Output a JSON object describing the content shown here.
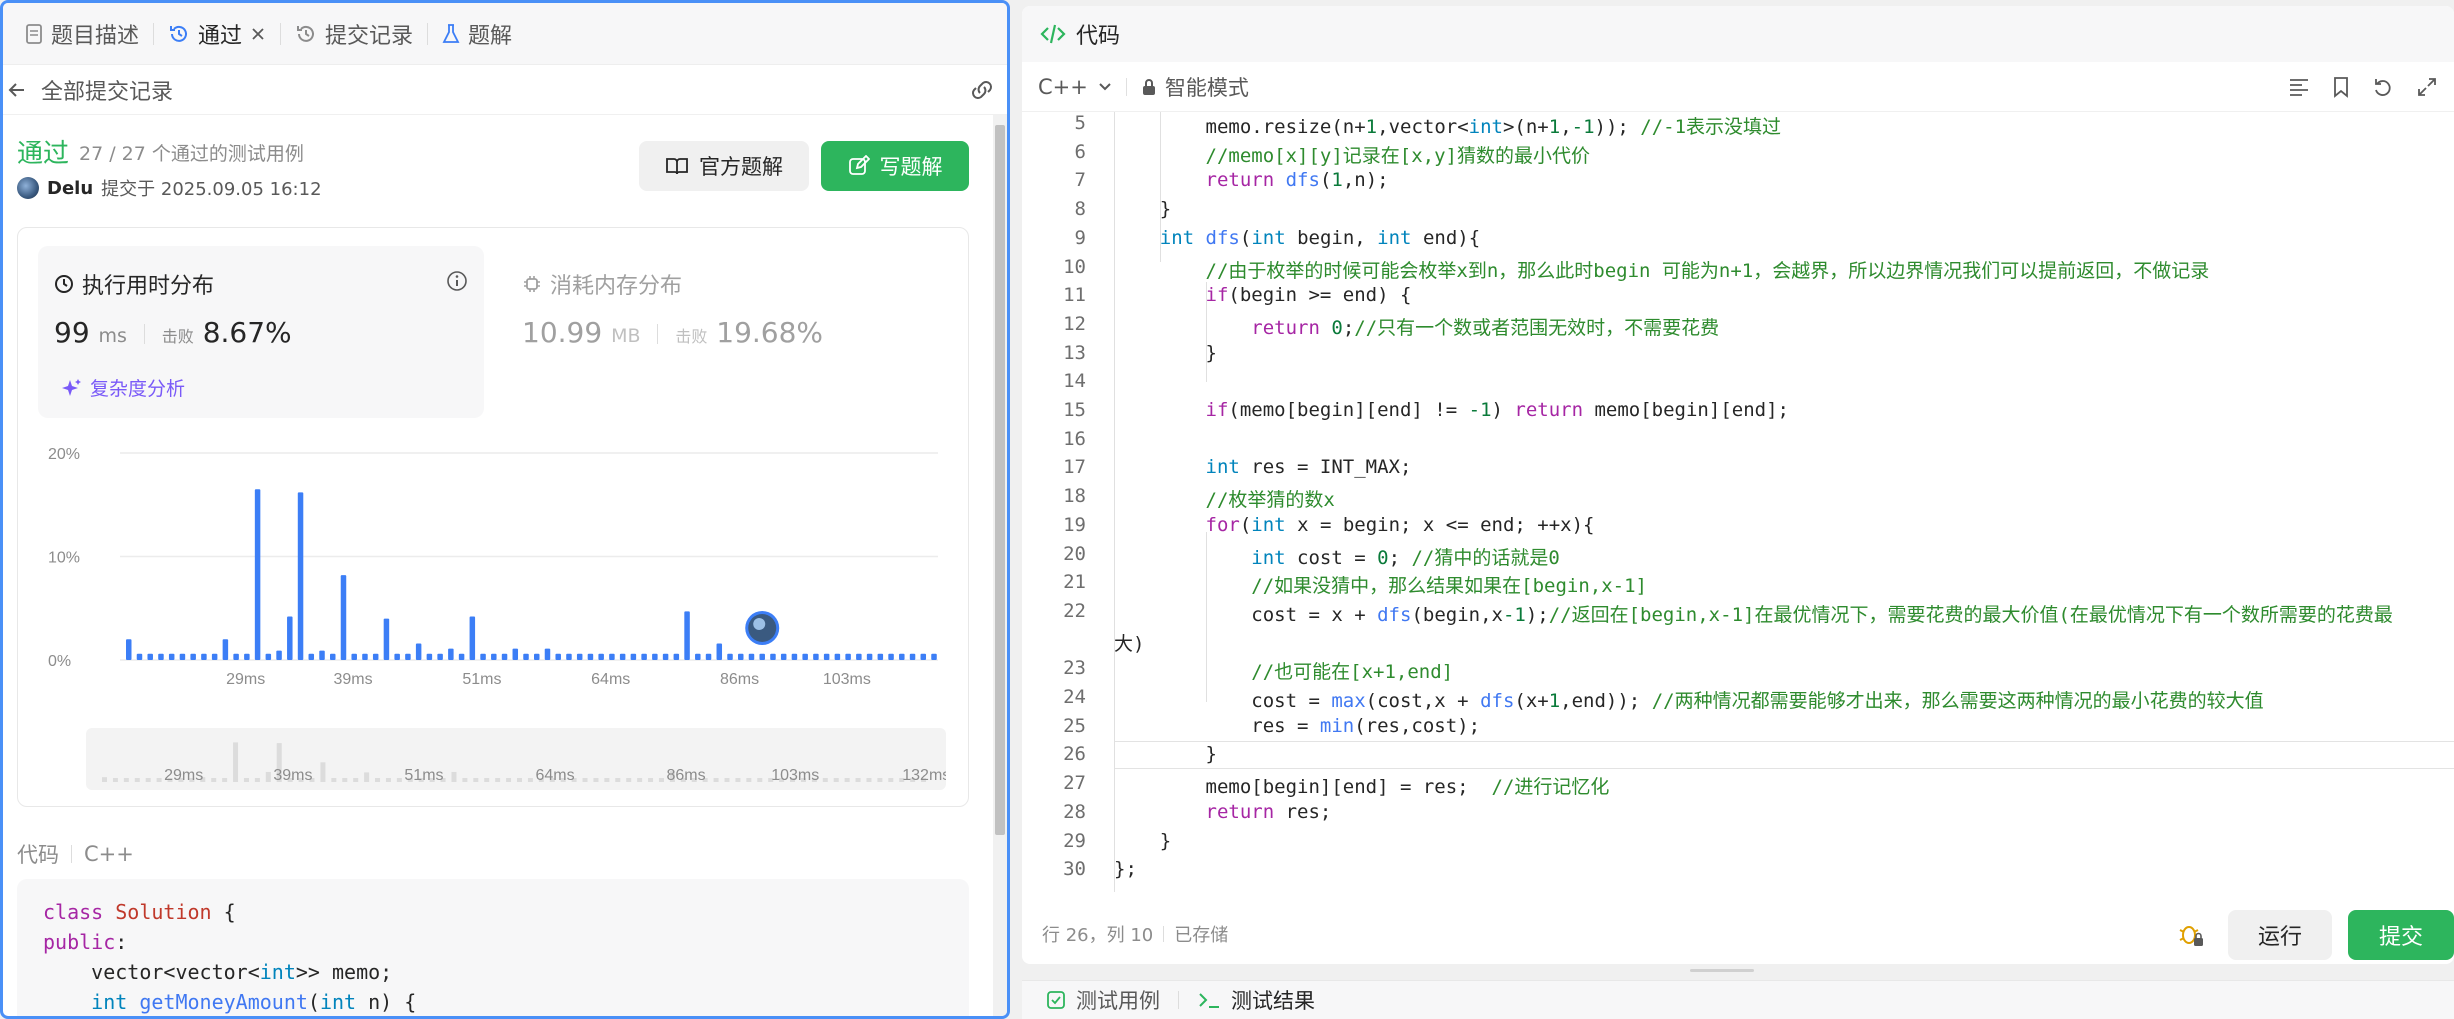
{
  "left_tabs": [
    {
      "label": "题目描述",
      "icon": "document-icon"
    },
    {
      "label": "通过",
      "icon": "history-icon",
      "active": true,
      "closable": true
    },
    {
      "label": "提交记录",
      "icon": "history-icon"
    },
    {
      "label": "题解",
      "icon": "flask-icon"
    }
  ],
  "header": {
    "back_label": "全部提交记录",
    "link_icon": "link-icon"
  },
  "submission": {
    "status": "通过",
    "testcases": "27 / 27 个通过的测试用例",
    "author": "Delu",
    "submitted_at": "提交于 2025.09.05 16:12",
    "official_solution": "官方题解",
    "write_solution": "写题解"
  },
  "runtime": {
    "title": "执行用时分布",
    "value": "99",
    "unit": "ms",
    "beat_label": "击败",
    "beat_pct": "8.67%",
    "complexity": "复杂度分析"
  },
  "memory": {
    "title": "消耗内存分布",
    "value": "10.99",
    "unit": "MB",
    "beat_label": "击败",
    "beat_pct": "19.68%"
  },
  "chart_data": {
    "type": "bar",
    "y_ticks": [
      "20%",
      "10%",
      "0%"
    ],
    "ylim": [
      0,
      20
    ],
    "x_ticks": [
      "29ms",
      "39ms",
      "51ms",
      "64ms",
      "86ms",
      "103ms",
      "132ms"
    ],
    "values": [
      2,
      0.6,
      0.6,
      0.6,
      0.6,
      0.6,
      0.6,
      0.6,
      0.6,
      2,
      0.6,
      0.6,
      16.5,
      0.6,
      0.9,
      4.2,
      16.2,
      0.6,
      0.9,
      0.6,
      8.2,
      0.6,
      0.6,
      0.6,
      4,
      0.6,
      0.6,
      1.6,
      0.6,
      0.6,
      1.1,
      0.6,
      4.2,
      0.6,
      0.6,
      0.6,
      1.1,
      0.6,
      0.6,
      1.1,
      0.6,
      0.6,
      0.6,
      0.6,
      0.6,
      0.6,
      0.6,
      0.6,
      0.6,
      0.6,
      0.6,
      0.6,
      4.7,
      0.6,
      0.6,
      1.6,
      0.6,
      0.6,
      0.6,
      0.6,
      0.6,
      0.6,
      0.6,
      0.6,
      0.6,
      0.6,
      0.6,
      0.6,
      0.6,
      0.6,
      0.6,
      0.6,
      0.6,
      0.6,
      0.6,
      0.6
    ],
    "user_marker_index": 59,
    "accent": "#3c7ef6"
  },
  "code_section": {
    "label": "代码",
    "lang": "C++"
  },
  "code_preview": [
    "class Solution {",
    "public:",
    "    vector<vector<int>> memo;",
    "    int getMoneyAmount(int n) {"
  ],
  "editor": {
    "title": "代码",
    "language": "C++",
    "mode": "智能模式",
    "status_pos": "行 26，列 10",
    "status_saved": "已存储",
    "run": "运行",
    "submit": "提交"
  },
  "code_lines": [
    {
      "n": "5",
      "t": "        memo.resize(n+1,vector<int>(n+1,-1)); //-1表示没填过"
    },
    {
      "n": "6",
      "t": "        //memo[x][y]记录在[x,y]猜数的最小代价"
    },
    {
      "n": "7",
      "t": "        return dfs(1,n);"
    },
    {
      "n": "8",
      "t": "    }"
    },
    {
      "n": "9",
      "t": "    int dfs(int begin, int end){"
    },
    {
      "n": "10",
      "t": "        //由于枚举的时候可能会枚举x到n，那么此时begin 可能为n+1，会越界，所以边界情况我们可以提前返回，不做记录"
    },
    {
      "n": "11",
      "t": "        if(begin >= end) {"
    },
    {
      "n": "12",
      "t": "            return 0;//只有一个数或者范围无效时，不需要花费"
    },
    {
      "n": "13",
      "t": "        }"
    },
    {
      "n": "14",
      "t": ""
    },
    {
      "n": "15",
      "t": "        if(memo[begin][end] != -1) return memo[begin][end];"
    },
    {
      "n": "16",
      "t": ""
    },
    {
      "n": "17",
      "t": "        int res = INT_MAX;"
    },
    {
      "n": "18",
      "t": "        //枚举猜的数x"
    },
    {
      "n": "19",
      "t": "        for(int x = begin; x <= end; ++x){"
    },
    {
      "n": "20",
      "t": "            int cost = 0; //猜中的话就是0"
    },
    {
      "n": "21",
      "t": "            //如果没猜中，那么结果如果在[begin,x-1]"
    },
    {
      "n": "22",
      "t": "            cost = x + dfs(begin,x-1);//返回在[begin,x-1]在最优情况下，需要花费的最大价值(在最优情况下有一个数所需要的花费最"
    },
    {
      "n": "",
      "t": "大)"
    },
    {
      "n": "23",
      "t": "            //也可能在[x+1,end]"
    },
    {
      "n": "24",
      "t": "            cost = max(cost,x + dfs(x+1,end)); //两种情况都需要能够才出来，那么需要这两种情况的最小花费的较大值"
    },
    {
      "n": "25",
      "t": "            res = min(res,cost);"
    },
    {
      "n": "26",
      "t": "        }"
    },
    {
      "n": "27",
      "t": "        memo[begin][end] = res;  //进行记忆化"
    },
    {
      "n": "28",
      "t": "        return res;"
    },
    {
      "n": "29",
      "t": "    }"
    },
    {
      "n": "30",
      "t": "};"
    }
  ],
  "results_tabs": [
    {
      "label": "测试用例",
      "icon": "checkbox-icon"
    },
    {
      "label": "测试结果",
      "icon": "terminal-icon"
    }
  ]
}
